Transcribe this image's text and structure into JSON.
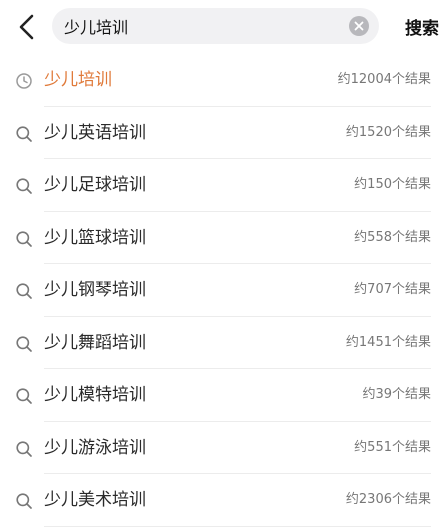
{
  "search": {
    "value": "少儿培训",
    "submit_label": "搜索"
  },
  "colors": {
    "accent": "#e07a3a",
    "searchBg": "#f1f1f3"
  },
  "suggestions": [
    {
      "label": "少儿培训",
      "count": "约12004个结果",
      "icon": "clock-icon",
      "highlight": true
    },
    {
      "label": "少儿英语培训",
      "count": "约1520个结果",
      "icon": "search-icon"
    },
    {
      "label": "少儿足球培训",
      "count": "约150个结果",
      "icon": "search-icon"
    },
    {
      "label": "少儿篮球培训",
      "count": "约558个结果",
      "icon": "search-icon"
    },
    {
      "label": "少儿钢琴培训",
      "count": "约707个结果",
      "icon": "search-icon"
    },
    {
      "label": "少儿舞蹈培训",
      "count": "约1451个结果",
      "icon": "search-icon"
    },
    {
      "label": "少儿模特培训",
      "count": "约39个结果",
      "icon": "search-icon"
    },
    {
      "label": "少儿游泳培训",
      "count": "约551个结果",
      "icon": "search-icon"
    },
    {
      "label": "少儿美术培训",
      "count": "约2306个结果",
      "icon": "search-icon"
    }
  ]
}
